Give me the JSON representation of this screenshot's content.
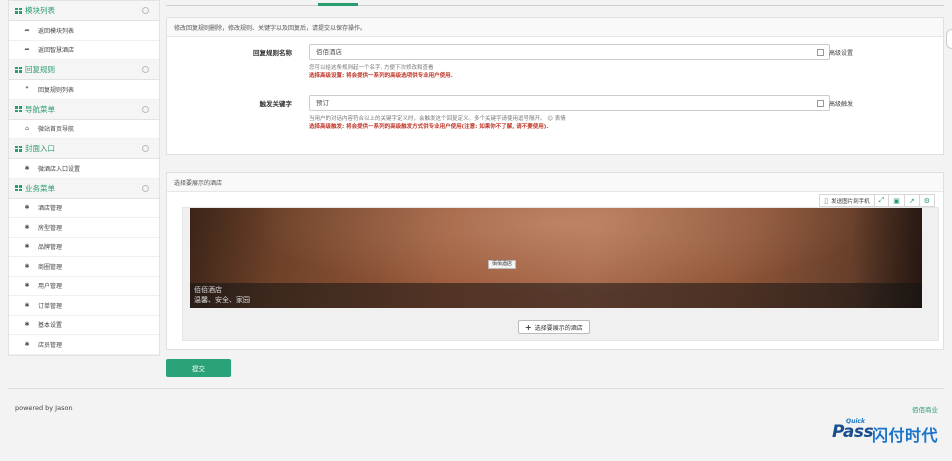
{
  "sidebar": {
    "groups": [
      {
        "title": "模块列表",
        "items": [
          {
            "label": "返回模块列表",
            "icon": "share-icon"
          },
          {
            "label": "返回智慧酒店",
            "icon": "share-icon"
          }
        ]
      },
      {
        "title": "回复规则",
        "items": [
          {
            "label": "回复规则列表",
            "icon": "comment-icon"
          }
        ]
      },
      {
        "title": "导航菜单",
        "items": [
          {
            "label": "微站首页导航",
            "icon": "home-icon"
          }
        ]
      },
      {
        "title": "封面入口",
        "items": [
          {
            "label": "微酒店入口设置",
            "icon": "pin-icon"
          }
        ]
      },
      {
        "title": "业务菜单",
        "items": [
          {
            "label": "酒店管理",
            "icon": "pin-icon"
          },
          {
            "label": "房型管理",
            "icon": "pin-icon"
          },
          {
            "label": "品牌管理",
            "icon": "pin-icon"
          },
          {
            "label": "商圈管理",
            "icon": "pin-icon"
          },
          {
            "label": "用户管理",
            "icon": "pin-icon"
          },
          {
            "label": "订单管理",
            "icon": "pin-icon"
          },
          {
            "label": "基本设置",
            "icon": "pin-icon"
          },
          {
            "label": "店员管理",
            "icon": "pin-icon"
          }
        ]
      }
    ]
  },
  "rule_panel": {
    "header_strong": "修改回复规则",
    "header_rest": " 删除，修改规则、关键字以及回复后，请提交以保存操作。",
    "name_label": "回复规则名称",
    "name_value": "佰佰酒店",
    "name_check": "高级设置",
    "name_help": "您可以给这条规则起一个名字, 方便下次修改和查看",
    "name_help_red": "选择高级设置: 将会提供一系列的高级选项供专业用户使用.",
    "kw_label": "触发关键字",
    "kw_value": "预订",
    "kw_check": "高级触发",
    "kw_help": "当用户的对话内容符合以上的关键字定义时，会触发这个回复定义。多个关键字请使用逗号隔开。",
    "kw_help_link": "表情",
    "kw_help_red": "选择高级触发: 将会提供一系列的高级触发方式供专业用户使用(注意: 如果你不了解, 请不要使用)."
  },
  "hotel_panel": {
    "header": "选择要展示的酒店",
    "toolbar": {
      "send_label": "发送图片到手机"
    },
    "image_tag": "佰佰酒店",
    "caption_title": "佰佰酒店",
    "caption_sub": "温馨、安全、家园",
    "select_button": "选择要展示的酒店"
  },
  "submit_label": "提交",
  "footer": {
    "powered": "powered by Jason",
    "brand": "佰佰商业"
  },
  "logo": {
    "quick": "Quick",
    "pass": "Pass",
    "cn": "闪付时代"
  }
}
